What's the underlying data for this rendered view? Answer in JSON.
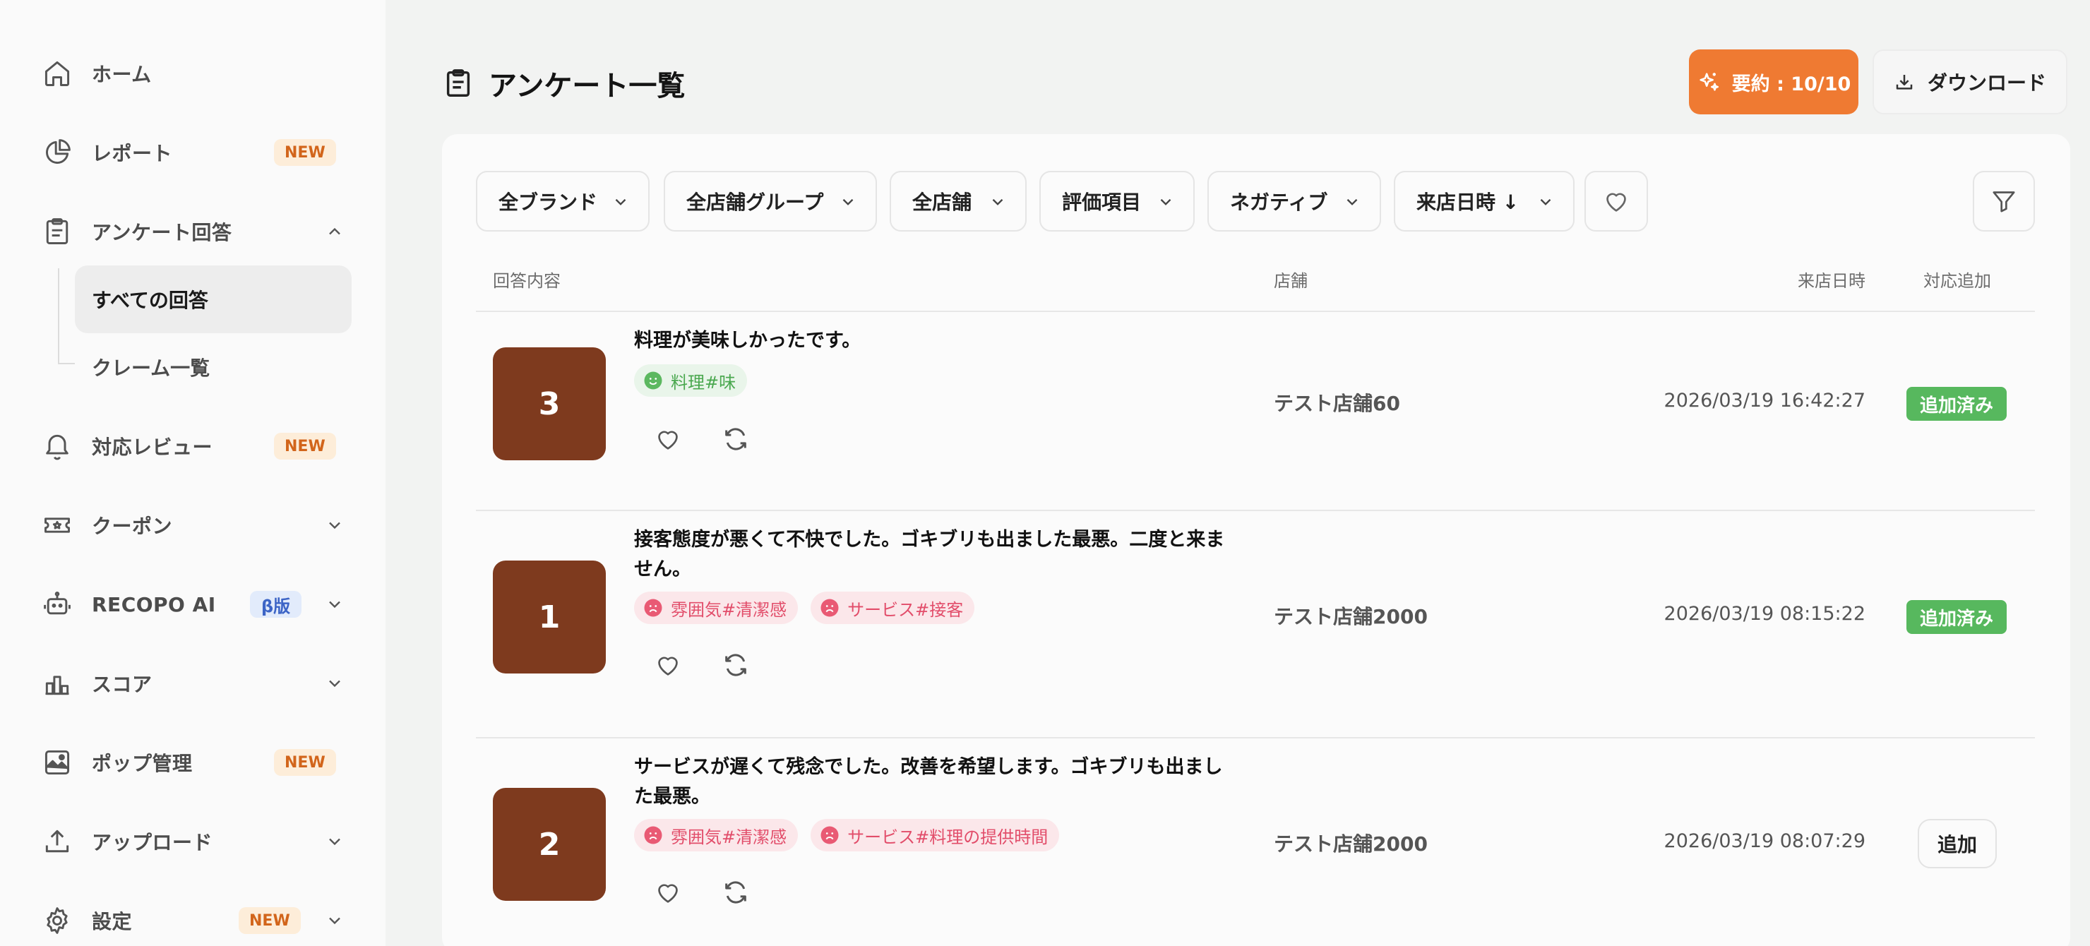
{
  "sidebar": {
    "items": [
      {
        "label": "ホーム",
        "icon": "home-icon"
      },
      {
        "label": "レポート",
        "icon": "pie-chart-icon",
        "badge": "NEW"
      },
      {
        "label": "アンケート回答",
        "icon": "clipboard-icon"
      },
      {
        "label": "対応レビュー",
        "icon": "bell-icon",
        "badge": "NEW"
      },
      {
        "label": "クーポン",
        "icon": "ticket-icon"
      },
      {
        "label": "RECOPO AI",
        "icon": "robot-icon",
        "badge": "β版"
      },
      {
        "label": "スコア",
        "icon": "bar-chart-icon"
      },
      {
        "label": "ポップ管理",
        "icon": "image-icon",
        "badge": "NEW"
      },
      {
        "label": "アップロード",
        "icon": "upload-icon"
      },
      {
        "label": "設定",
        "icon": "gear-icon",
        "badge": "NEW"
      }
    ],
    "sub_items": [
      {
        "label": "すべての回答",
        "active": true
      },
      {
        "label": "クレーム一覧",
        "active": false
      }
    ]
  },
  "header": {
    "title": "アンケート一覧",
    "summary_button": "要約 : 10/10",
    "download_button": "ダウンロード"
  },
  "filters": [
    "全ブランド",
    "全店舗グループ",
    "全店舗",
    "評価項目",
    "ネガティブ",
    "来店日時 ↓"
  ],
  "table": {
    "headers": {
      "content": "回答内容",
      "store": "店舗",
      "date": "来店日時",
      "action": "対応追加"
    },
    "rows": [
      {
        "score": "3",
        "comment": "料理が美味しかったです。",
        "tags": [
          {
            "label": "料理#味",
            "sentiment": "positive"
          }
        ],
        "store": "テスト店舗60",
        "date": "2026/03/19 16:42:27",
        "action": "追加済み"
      },
      {
        "score": "1",
        "comment": "接客態度が悪くて不快でした。ゴキブリも出ました最悪。二度と来ません。",
        "tags": [
          {
            "label": "雰囲気#清潔感",
            "sentiment": "negative"
          },
          {
            "label": "サービス#接客",
            "sentiment": "negative"
          }
        ],
        "store": "テスト店舗2000",
        "date": "2026/03/19 08:15:22",
        "action": "追加済み"
      },
      {
        "score": "2",
        "comment": "サービスが遅くて残念でした。改善を希望します。ゴキブリも出ました最悪。",
        "tags": [
          {
            "label": "雰囲気#清潔感",
            "sentiment": "negative"
          },
          {
            "label": "サービス#料理の提供時間",
            "sentiment": "negative"
          }
        ],
        "store": "テスト店舗2000",
        "date": "2026/03/19 08:07:29",
        "action": "追加"
      }
    ]
  },
  "colors": {
    "accent": "#ef7a32",
    "score_bg": "#7e3a1e",
    "added_green": "#57b85e",
    "positive_tag": "#4aa84f",
    "negative_tag": "#e24d6a"
  }
}
